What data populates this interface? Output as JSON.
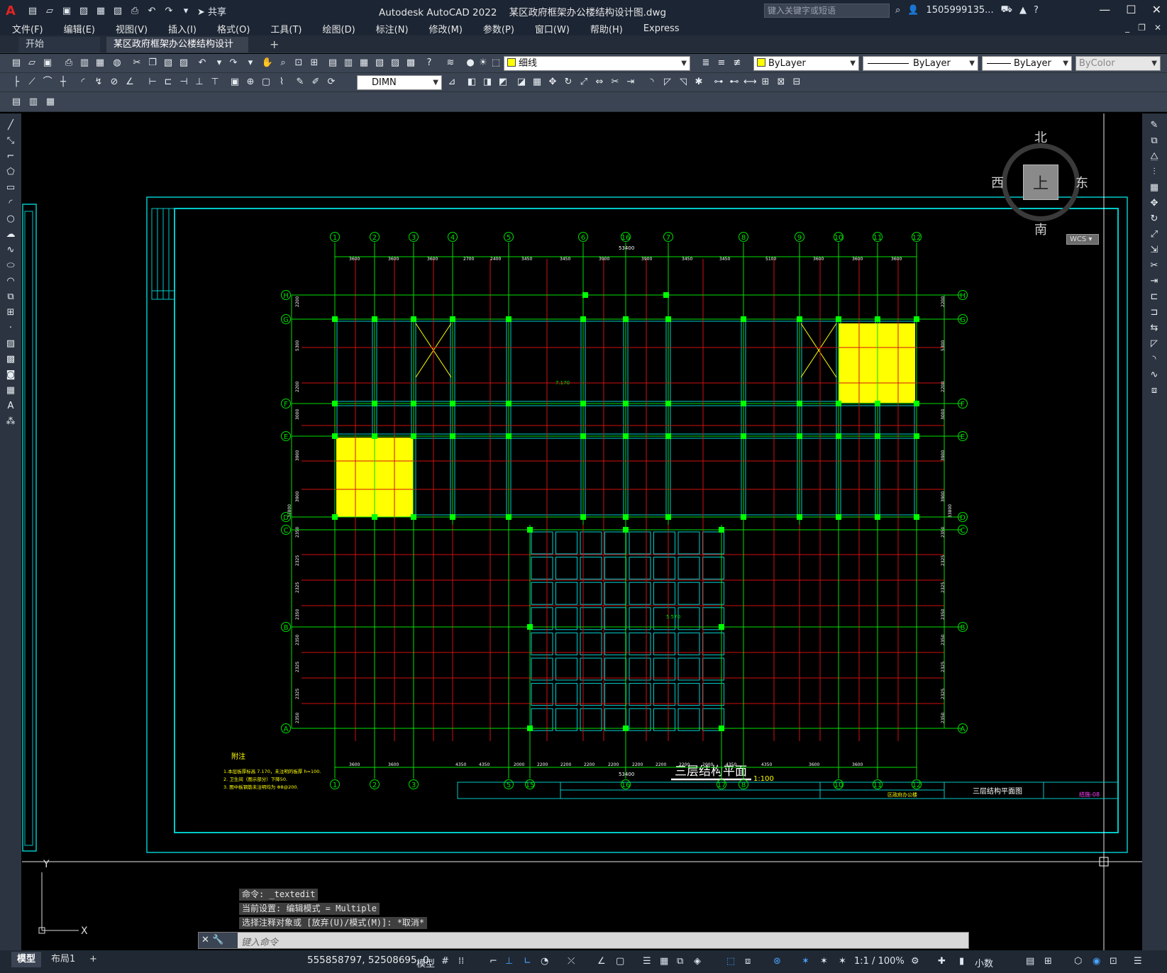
{
  "title_bar": {
    "app_title": "Autodesk AutoCAD 2022",
    "doc_title": "某区政府框架办公楼结构设计图.dwg",
    "share_label": "共享",
    "search_placeholder": "键入关键字或短语",
    "user": "1505999135...",
    "logo": "A"
  },
  "menu": [
    "文件(F)",
    "编辑(E)",
    "视图(V)",
    "插入(I)",
    "格式(O)",
    "工具(T)",
    "绘图(D)",
    "标注(N)",
    "修改(M)",
    "参数(P)",
    "窗口(W)",
    "帮助(H)",
    "Express"
  ],
  "tabs": {
    "start": "开始",
    "doc": "某区政府框架办公楼结构设计图*",
    "close": "×",
    "add": "+"
  },
  "toolbar": {
    "layer_value": "细线",
    "color_value": "ByLayer",
    "linetype_value": "ByLayer",
    "lineweight_value": "ByLayer",
    "plotstyle_value": "ByColor",
    "dimstyle_value": "DIMN"
  },
  "viewcube": {
    "north": "北",
    "south": "南",
    "east": "东",
    "west": "西",
    "top": "上",
    "wcs": "WCS"
  },
  "ucs": {
    "y": "Y",
    "x": "X"
  },
  "drawing": {
    "columns_top": [
      "1",
      "2",
      "3",
      "4",
      "5",
      "6",
      "16",
      "7",
      "8",
      "9",
      "10",
      "11",
      "12"
    ],
    "columns_bottom": [
      "1",
      "2",
      "3",
      "5",
      "15",
      "16",
      "17",
      "8",
      "10",
      "11",
      "12"
    ],
    "rows": [
      "H",
      "G",
      "F",
      "E",
      "D",
      "C",
      "B",
      "A"
    ],
    "total_dim": "53400",
    "top_spans": [
      "3600",
      "3600",
      "3600",
      "2700",
      "2400",
      "3450",
      "3450",
      "3900",
      "3900",
      "3450",
      "3450",
      "5100",
      "3600",
      "3600",
      "3600"
    ],
    "bottom_spans": [
      "3600",
      "3600",
      "4350",
      "4350",
      "2000",
      "2200",
      "2200",
      "2200",
      "2200",
      "2200",
      "2200",
      "2200",
      "2000",
      "4350",
      "4350",
      "3600",
      "3600"
    ],
    "left_dims": [
      "2200",
      "5300",
      "2200",
      "3000",
      "3900",
      "3900",
      "2350",
      "2325",
      "2325",
      "2350",
      "2350",
      "2325",
      "2325",
      "2350"
    ],
    "left_total": "33800",
    "level_mark": "7.170",
    "level_mark_2": "5.570",
    "notes_title": "附注",
    "notes": [
      "1.本层板厚标高 7.170，未注明的板厚 h=100.",
      "2. 卫生间（图示部分）下降50.",
      "3. 图中板钢筋未注明均为 Φ8@200."
    ],
    "plan_title": "三层结构平面",
    "plan_scale": "1:100",
    "tb_drawing_name": "三层结构平面图",
    "tb_project": "区政府办公楼",
    "tb_drawing_no": "结施-08"
  },
  "command": {
    "history": [
      "命令: _textedit",
      "当前设置: 编辑模式 = Multiple",
      "选择注释对象或 [放弃(U)/模式(M)]: *取消*"
    ],
    "placeholder": "键入命令"
  },
  "status": {
    "layout_tabs": [
      "模型",
      "布局1"
    ],
    "add_layout": "+",
    "coords": "555858797, 52508695, 0",
    "model": "模型",
    "scale": "1:1 / 100%",
    "units": "小数"
  },
  "colors": {
    "bg": "#000000",
    "frame": "#00d0d0",
    "grid": "#00e000",
    "beam": "#d01010",
    "column": "#00ff00",
    "highlight": "#ffff00",
    "ui": "#3b4453"
  }
}
